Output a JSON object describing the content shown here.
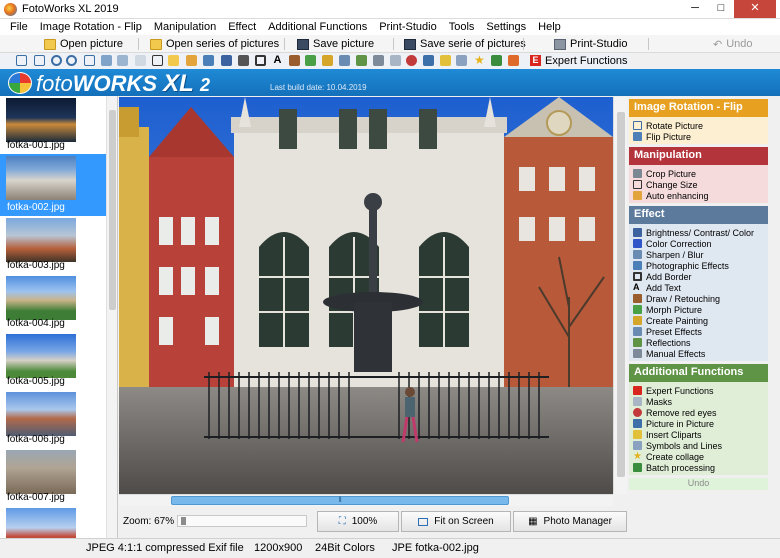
{
  "window": {
    "title": "FotoWorks XL 2019",
    "controls": [
      "─",
      "□",
      "✕"
    ]
  },
  "menu": [
    "File",
    "Image Rotation - Flip",
    "Manipulation",
    "Effect",
    "Additional Functions",
    "Print-Studio",
    "Tools",
    "Settings",
    "Help"
  ],
  "commands": {
    "open_picture": "Open picture",
    "open_series": "Open series of pictures",
    "save_picture": "Save picture",
    "save_series": "Save serie of pictures",
    "print_studio": "Print-Studio",
    "undo": "Undo",
    "expert": "Expert Functions"
  },
  "banner": {
    "logo_foto": "foto",
    "logo_works": "WORKS",
    "logo_xl": "XL",
    "logo_ver": "2",
    "build_date": "Last build date: 10.04.2019"
  },
  "thumbnails": [
    {
      "name": "fotka-001.jpg",
      "selected": false
    },
    {
      "name": "fotka-002.jpg",
      "selected": true
    },
    {
      "name": "fotka-003.jpg",
      "selected": false
    },
    {
      "name": "fotka-004.jpg",
      "selected": false
    },
    {
      "name": "fotka-005.jpg",
      "selected": false
    },
    {
      "name": "fotka-006.jpg",
      "selected": false
    },
    {
      "name": "fotka-007.jpg",
      "selected": false
    },
    {
      "name": "",
      "selected": false
    }
  ],
  "zoom": {
    "label": "Zoom: 67%",
    "btn_100": "100%",
    "btn_fit": "Fit on Screen",
    "btn_manager": "Photo Manager"
  },
  "side_panel": {
    "rotation": {
      "title": "Image Rotation - Flip",
      "color": "#e8a020",
      "items": [
        "Rotate Picture",
        "Flip Picture"
      ]
    },
    "manipulation": {
      "title": "Manipulation",
      "color": "#b4343c",
      "items": [
        "Crop Picture",
        "Change Size",
        "Auto enhancing"
      ]
    },
    "effect": {
      "title": "Effect",
      "color": "#5c7a9b",
      "items": [
        "Brightness/ Contrast/ Color",
        "Color Correction",
        "Sharpen / Blur",
        "Photographic Effects",
        "Add Border",
        "Add Text",
        "Draw / Retouching",
        "Morph Picture",
        "Create Painting",
        "Preset Effects",
        "Reflections",
        "Manual Effects"
      ]
    },
    "additional": {
      "title": "Additional Functions",
      "color": "#5f9447",
      "items": [
        "Expert Functions",
        "Masks",
        "Remove red eyes",
        "Picture in Picture",
        "Insert Cliparts",
        "Symbols and Lines",
        "Create collage",
        "Batch processing"
      ]
    },
    "undo": "Undo"
  },
  "status": {
    "format": "JPEG 4:1:1 compressed Exif file",
    "size": "1200x900",
    "colors": "24Bit Colors",
    "file": "JPE fotka-002.jpg"
  }
}
